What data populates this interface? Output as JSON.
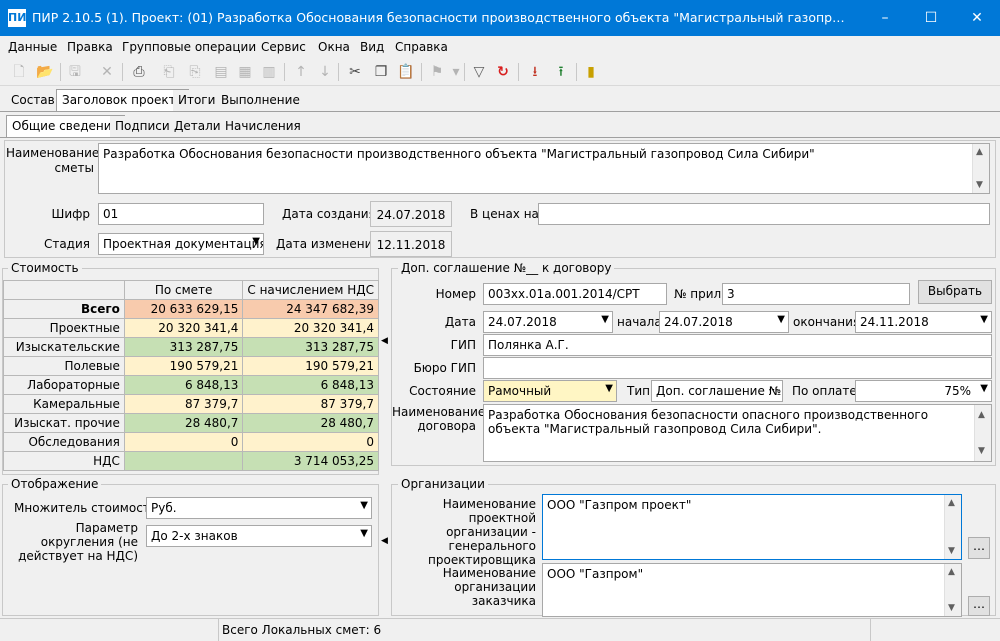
{
  "window": {
    "app_icon": "ПИР",
    "title": "ПИР 2.10.5 (1). Проект: (01) Разработка Обоснования безопасности  производственного объекта \"Магистральный газопровод Сила С..."
  },
  "menu": [
    "Данные",
    "Правка",
    "Групповые операции",
    "Сервис",
    "Окна",
    "Вид",
    "Справка"
  ],
  "toolbar_icons": [
    "new-document-icon",
    "open-folder-icon",
    "save-icon",
    "delete-icon",
    "print-icon",
    "copy-doc-icon",
    "move-doc-icon",
    "doc-icon",
    "doc-arrow-icon",
    "doc-export-icon",
    "arrow-up-icon",
    "arrow-down-icon",
    "cut-icon",
    "copy-icon",
    "paste-icon",
    "stamp-icon",
    "filter-icon",
    "refresh-icon",
    "import-icon",
    "export-icon",
    "exit-icon"
  ],
  "tabs_top": [
    "Состав",
    "Заголовок проекта",
    "Итоги",
    "Выполнение"
  ],
  "tabs_sub": [
    "Общие сведения",
    "Подписи",
    "Детали",
    "Начисления"
  ],
  "general": {
    "name_label": "Наименование сметы",
    "name_value": "Разработка Обоснования безопасности  производственного объекта \"Магистральный газопровод Сила Сибири\"",
    "code_label": "Шифр",
    "code_value": "01",
    "created_label": "Дата создания",
    "created_value": "24.07.2018",
    "prices_label": "В ценах на",
    "prices_value": "",
    "stage_label": "Стадия",
    "stage_value": "Проектная документация",
    "changed_label": "Дата изменения",
    "changed_value": "12.11.2018"
  },
  "cost": {
    "title": "Стоимость",
    "col1": "По смете",
    "col2": "С начислением НДС",
    "rows": [
      {
        "label": "Всего",
        "v1": "20 633 629,15",
        "v2": "24 347 682,39"
      },
      {
        "label": "Проектные",
        "v1": "20 320 341,4",
        "v2": "20 320 341,4"
      },
      {
        "label": "Изыскательские",
        "v1": "313 287,75",
        "v2": "313 287,75"
      },
      {
        "label": "Полевые",
        "v1": "190 579,21",
        "v2": "190 579,21"
      },
      {
        "label": "Лабораторные",
        "v1": "6 848,13",
        "v2": "6 848,13"
      },
      {
        "label": "Камеральные",
        "v1": "87 379,7",
        "v2": "87 379,7"
      },
      {
        "label": "Изыскат. прочие",
        "v1": "28 480,7",
        "v2": "28 480,7"
      },
      {
        "label": "Обследования",
        "v1": "0",
        "v2": "0"
      },
      {
        "label": "НДС",
        "v1": "",
        "v2": "3 714 053,25"
      }
    ]
  },
  "display": {
    "title": "Отображение",
    "multiplier_label": "Множитель стоимости",
    "multiplier_value": "Руб.",
    "rounding_label": "Параметр округления (не действует на НДС)",
    "rounding_value": "До 2-х знаков"
  },
  "agreement": {
    "title": "Доп. соглашение №__ к договору",
    "number_label": "Номер",
    "number_value": "003xx.01a.001.2014/CPT",
    "app_label": "№ прил.",
    "app_value": "3",
    "select_button": "Выбрать",
    "date_label": "Дата",
    "date_value": "24.07.2018",
    "start_label": "начала",
    "start_value": "24.07.2018",
    "end_label": "окончания",
    "end_value": "24.11.2018",
    "gip_label": "ГИП",
    "gip_value": "Полянка А.Г.",
    "bureau_label": "Бюро ГИП",
    "bureau_value": "",
    "state_label": "Состояние",
    "state_value": "Рамочный",
    "type_label": "Тип",
    "type_value": "Доп. соглашение №...",
    "payment_label": "По оплате",
    "payment_value": "75%",
    "contract_label": "Наименование договора",
    "contract_value": "Разработка Обоснования безопасности опасного производственного объекта \"Магистральный газопровод Сила Сибири\"."
  },
  "orgs": {
    "title": "Организации",
    "design_label": "Наименование проектной организации - генерального проектировщика",
    "design_value": "ООО \"Газпром проект\"",
    "customer_label": "Наименование организации заказчика",
    "customer_value": "ООО \"Газпром\""
  },
  "status_text": "Всего Локальных смет: 6"
}
